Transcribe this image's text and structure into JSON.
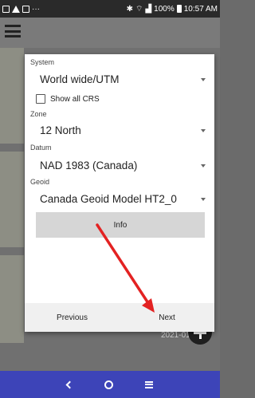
{
  "status_bar": {
    "left_icons": [
      "gallery-icon",
      "alert-triangle-icon",
      "gallery-icon",
      "more-dots-icon"
    ],
    "more_text": "···",
    "right_icons": [
      "nfc-icon",
      "bluetooth-icon",
      "vibrate-icon",
      "no-sim-icon",
      "wifi-icon",
      "signal-icon",
      "battery-icon"
    ],
    "battery": "100%",
    "time": "10:57 AM"
  },
  "app_bar": {
    "menu_icon": "hamburger-menu-icon"
  },
  "dialog": {
    "system": {
      "label": "System",
      "value": "World wide/UTM"
    },
    "show_all_crs": {
      "label": "Show all CRS",
      "checked": false
    },
    "zone": {
      "label": "Zone",
      "value": "12 North"
    },
    "datum": {
      "label": "Datum",
      "value": "NAD 1983 (Canada)"
    },
    "geoid": {
      "label": "Geoid",
      "value": "Canada Geoid Model HT2_0"
    },
    "info_button": "Info",
    "previous_button": "Previous",
    "next_button": "Next"
  },
  "background": {
    "date_text": "2021-01-25 9:",
    "fab_icon": "plus-icon"
  },
  "annotation": {
    "arrow_color": "#e32222"
  },
  "nav_bar": {
    "color": "#3d44b8",
    "icons": [
      "back-icon",
      "home-icon",
      "recents-icon"
    ]
  }
}
